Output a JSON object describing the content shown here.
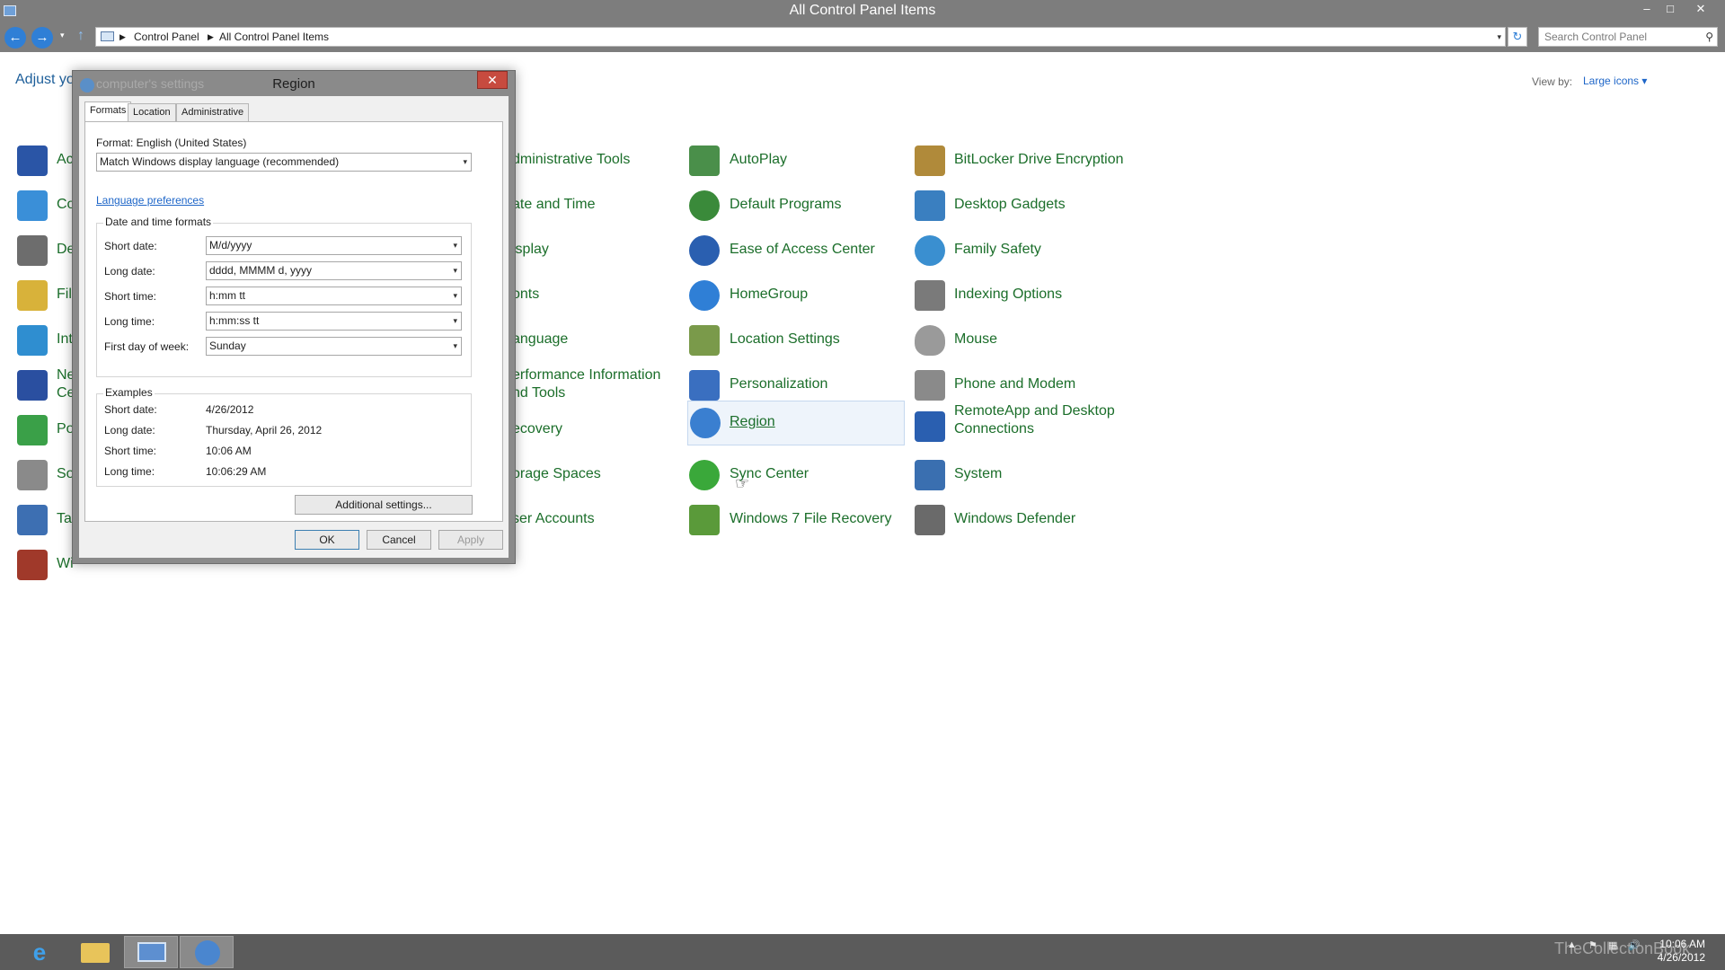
{
  "window": {
    "title": "All Control Panel Items",
    "minimize": "–",
    "restore": "□",
    "close": "✕"
  },
  "nav": {
    "back": "←",
    "forward": "→",
    "up": "↑",
    "dropdown": "▾",
    "breadcrumbs": [
      "Control Panel",
      "All Control Panel Items"
    ],
    "refresh": "↻",
    "search_placeholder": "Search Control Panel"
  },
  "main": {
    "heading": "Adjust yo",
    "view_by_label": "View by:",
    "view_by_value": "Large icons ▾"
  },
  "items": [
    {
      "label": "Ac",
      "icon": "action-center-icon",
      "color": "#2a55a6"
    },
    {
      "label": "Co",
      "icon": "color-management-icon",
      "color": "#3a8fd8"
    },
    {
      "label": "De",
      "icon": "devices-icon",
      "color": "#6d6d6d"
    },
    {
      "label": "File",
      "icon": "file-history-icon",
      "color": "#d8b23a"
    },
    {
      "label": "Int",
      "icon": "internet-options-icon",
      "color": "#2f8ed0"
    },
    {
      "label": "Ne",
      "label2": "Ce",
      "icon": "network-sharing-icon",
      "color": "#2a4fa0"
    },
    {
      "label": "Po",
      "icon": "power-options-icon",
      "color": "#3aa048"
    },
    {
      "label": "So",
      "icon": "sound-icon",
      "color": "#8a8a8a"
    },
    {
      "label": "Tas",
      "icon": "taskbar-icon",
      "color": "#3d6fb2"
    },
    {
      "label": "Wi",
      "icon": "windows-firewall-icon",
      "color": "#a0392a"
    },
    {
      "label": "dministrative Tools",
      "icon": "",
      "color": ""
    },
    {
      "label": "ate and Time",
      "icon": "",
      "color": ""
    },
    {
      "label": "isplay",
      "icon": "",
      "color": ""
    },
    {
      "label": "onts",
      "icon": "",
      "color": ""
    },
    {
      "label": "anguage",
      "icon": "",
      "color": ""
    },
    {
      "label": "erformance Information",
      "label2": "nd Tools",
      "icon": "",
      "color": ""
    },
    {
      "label": "ecovery",
      "icon": "",
      "color": ""
    },
    {
      "label": "orage Spaces",
      "icon": "",
      "color": ""
    },
    {
      "label": "ser Accounts",
      "icon": "",
      "color": ""
    },
    {
      "label": "AutoPlay",
      "icon": "autoplay-icon",
      "color": "#4a8f4a"
    },
    {
      "label": "Default Programs",
      "icon": "default-programs-icon",
      "color": "#3a8a3a"
    },
    {
      "label": "Ease of Access Center",
      "icon": "ease-of-access-icon",
      "color": "#2a5fb0"
    },
    {
      "label": "HomeGroup",
      "icon": "homegroup-icon",
      "color": "#2f7fd6"
    },
    {
      "label": "Location Settings",
      "icon": "location-settings-icon",
      "color": "#7a9a4a"
    },
    {
      "label": "Personalization",
      "icon": "personalization-icon",
      "color": "#3a6fc0"
    },
    {
      "label": "Region",
      "icon": "region-icon",
      "color": "#3a7fd0"
    },
    {
      "label": "Sync Center",
      "icon": "sync-center-icon",
      "color": "#3aa83a"
    },
    {
      "label": "Windows 7 File Recovery",
      "icon": "file-recovery-icon",
      "color": "#5a9a3a"
    },
    {
      "label": "BitLocker Drive Encryption",
      "icon": "bitlocker-icon",
      "color": "#b08a3a"
    },
    {
      "label": "Desktop Gadgets",
      "icon": "desktop-gadgets-icon",
      "color": "#3a7fc0"
    },
    {
      "label": "Family Safety",
      "icon": "family-safety-icon",
      "color": "#3a8fd0"
    },
    {
      "label": "Indexing Options",
      "icon": "indexing-options-icon",
      "color": "#7a7a7a"
    },
    {
      "label": "Mouse",
      "icon": "mouse-icon",
      "color": "#9a9a9a"
    },
    {
      "label": "Phone and Modem",
      "icon": "phone-modem-icon",
      "color": "#8a8a8a"
    },
    {
      "label": "RemoteApp and Desktop",
      "label2": "Connections",
      "icon": "remoteapp-icon",
      "color": "#2a5fb0"
    },
    {
      "label": "System",
      "icon": "system-icon",
      "color": "#3a6fb0"
    },
    {
      "label": "Windows Defender",
      "icon": "windows-defender-icon",
      "color": "#6a6a6a"
    }
  ],
  "dialog": {
    "title": "Region",
    "ghost_title": "computer's settings",
    "close": "✕",
    "tabs": [
      "Formats",
      "Location",
      "Administrative"
    ],
    "format_label": "Format: English (United States)",
    "format_value": "Match Windows display language (recommended)",
    "language_link": "Language preferences",
    "dt_group_title": "Date and time formats",
    "dt_rows": [
      {
        "label": "Short date:",
        "value": "M/d/yyyy"
      },
      {
        "label": "Long date:",
        "value": "dddd, MMMM d, yyyy"
      },
      {
        "label": "Short time:",
        "value": "h:mm tt"
      },
      {
        "label": "Long time:",
        "value": "h:mm:ss tt"
      },
      {
        "label": "First day of week:",
        "value": "Sunday"
      }
    ],
    "examples_title": "Examples",
    "examples": [
      {
        "label": "Short date:",
        "value": "4/26/2012"
      },
      {
        "label": "Long date:",
        "value": "Thursday, April 26, 2012"
      },
      {
        "label": "Short time:",
        "value": "10:06 AM"
      },
      {
        "label": "Long time:",
        "value": "10:06:29 AM"
      }
    ],
    "additional_settings": "Additional settings...",
    "ok": "OK",
    "cancel": "Cancel",
    "apply": "Apply",
    "arrow": "▾"
  },
  "taskbar": {
    "items": [
      "internet-explorer-icon",
      "file-explorer-icon",
      "control-panel-icon",
      "region-icon"
    ],
    "time": "10:06 AM",
    "date": "4/26/2012",
    "watermark": "TheCollectionBook"
  }
}
